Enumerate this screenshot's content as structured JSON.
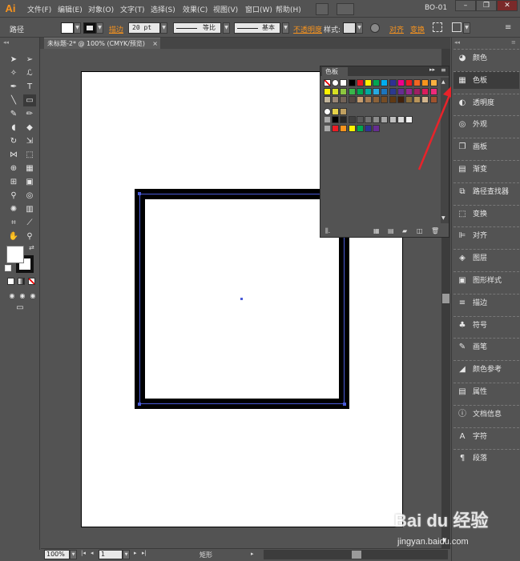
{
  "menubar": {
    "logo": "Ai",
    "items": [
      "文件(F)",
      "编辑(E)",
      "对象(O)",
      "文字(T)",
      "选择(S)",
      "效果(C)",
      "视图(V)",
      "窗口(W)",
      "帮助(H)"
    ],
    "workspace": "BO-01"
  },
  "controlbar": {
    "object_type": "路径",
    "stroke_label": "描边",
    "stroke_weight": "20 pt",
    "profile_uniform": "等比",
    "brush_basic": "基本",
    "opacity_label": "不透明度",
    "style_label": "样式:",
    "align_label": "对齐",
    "transform_label": "变换"
  },
  "document": {
    "tab_title": "未标题-2* @ 100% (CMYK/预览)"
  },
  "statusbar": {
    "zoom": "100%",
    "page": "1",
    "tool_name": "矩形"
  },
  "swatches_panel": {
    "title": "色板"
  },
  "right_dock": {
    "items": [
      {
        "label": "颜色",
        "icon": "color-icon"
      },
      {
        "label": "色板",
        "icon": "swatches-icon"
      },
      {
        "label": "透明度",
        "icon": "transparency-icon"
      },
      {
        "label": "外观",
        "icon": "appearance-icon"
      },
      {
        "label": "画板",
        "icon": "artboards-icon"
      },
      {
        "label": "渐变",
        "icon": "gradient-icon"
      },
      {
        "label": "路径查找器",
        "icon": "pathfinder-icon"
      },
      {
        "label": "变换",
        "icon": "transform-icon"
      },
      {
        "label": "对齐",
        "icon": "align-icon"
      },
      {
        "label": "图层",
        "icon": "layers-icon"
      },
      {
        "label": "图形样式",
        "icon": "graphic-styles-icon"
      },
      {
        "label": "描边",
        "icon": "stroke-icon"
      },
      {
        "label": "符号",
        "icon": "symbols-icon"
      },
      {
        "label": "画笔",
        "icon": "brushes-icon"
      },
      {
        "label": "颜色参考",
        "icon": "color-guide-icon"
      },
      {
        "label": "属性",
        "icon": "attributes-icon"
      },
      {
        "label": "文档信息",
        "icon": "document-info-icon"
      },
      {
        "label": "字符",
        "icon": "character-icon"
      },
      {
        "label": "段落",
        "icon": "paragraph-icon"
      }
    ]
  },
  "colors": {
    "app_bg": "#535353",
    "accent_orange": "#f7931e",
    "annotation_arrow": "#e8232a",
    "selection_blue": "#4a5bd8"
  },
  "watermark": {
    "brand": "Bai du 经验",
    "url": "jingyan.baidu.com"
  }
}
